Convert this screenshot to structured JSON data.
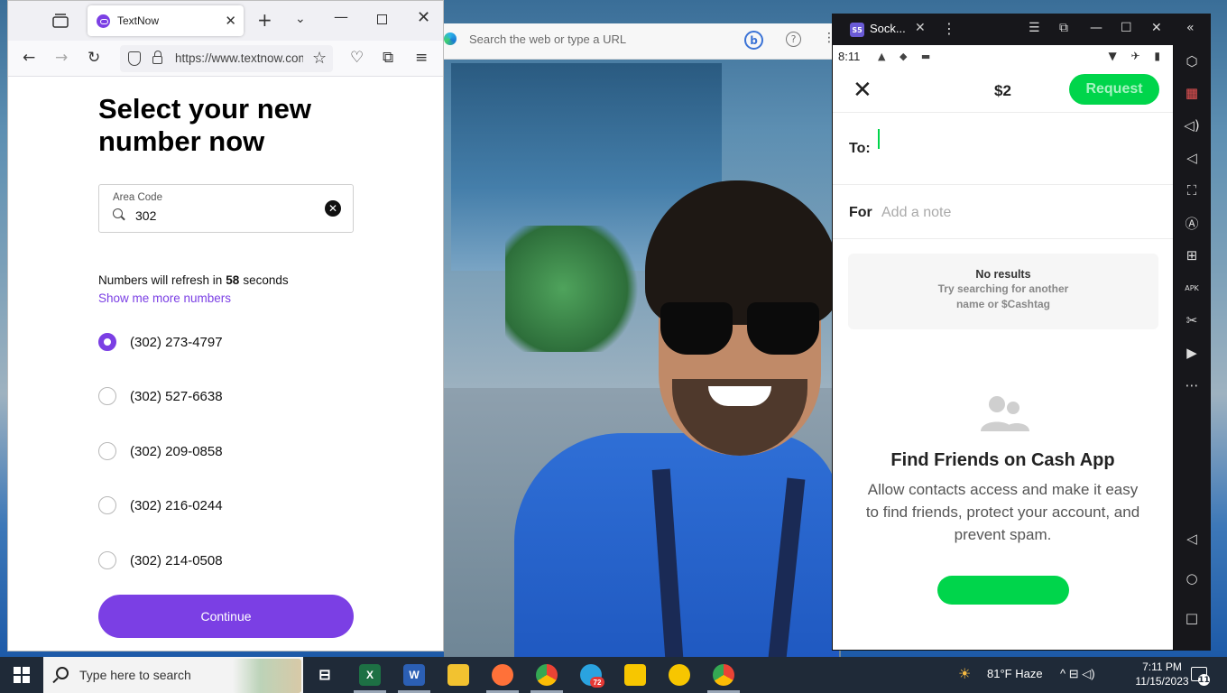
{
  "edge": {
    "search_placeholder": "Search the web or type a URL",
    "bing_label": "b",
    "help_label": "?",
    "more_label": "⋮"
  },
  "firefox": {
    "tab_title": "TextNow",
    "url": "https://www.textnow.com",
    "newtab_label": "+",
    "list_tabs_label": "⌄",
    "min_label": "—",
    "close_label": "✕",
    "tab_close_label": "✕",
    "back_label": "←",
    "forward_label": "→",
    "reload_label": "↻",
    "star_label": "☆",
    "pocket_label": "♡",
    "extensions_label": "⧉",
    "menu_label": "≡"
  },
  "textnow": {
    "heading": "Select your new number now",
    "area_code_label": "Area Code",
    "area_code_value": "302",
    "clear_label": "✕",
    "refresh_prefix": "Numbers will refresh in",
    "refresh_seconds": "58",
    "refresh_suffix": "seconds",
    "more_numbers_link": "Show me more numbers",
    "numbers": [
      {
        "number": "(302) 273-4797",
        "selected": true
      },
      {
        "number": "(302) 527-6638",
        "selected": false
      },
      {
        "number": "(302) 209-0858",
        "selected": false
      },
      {
        "number": "(302) 216-0244",
        "selected": false
      },
      {
        "number": "(302) 214-0508",
        "selected": false
      }
    ],
    "continue_label": "Continue",
    "accent_color": "#7b3fe4"
  },
  "emulator": {
    "window_title": "Sock...",
    "icon_label": "S5",
    "tab_close": "✕",
    "menu_dots": "⋮",
    "controls": [
      "☰",
      "⧉",
      "—",
      "☐",
      "✕",
      "«"
    ],
    "side_icons": [
      "settings-icon",
      "screenshot-disabled-icon",
      "volume-up-icon",
      "volume-down-icon",
      "fullscreen-icon",
      "rotate-icon",
      "add-window-icon",
      "apk-icon",
      "scissors-icon",
      "media-icon",
      "more-icon",
      "back-nav-icon",
      "home-nav-icon",
      "recent-nav-icon"
    ],
    "side_glyphs": [
      "⬡",
      "▦",
      "◁)",
      "◁",
      "⛶",
      "Ⓐ",
      "⊞",
      "APK",
      "✂",
      "▶",
      "⋯",
      "◁",
      "○",
      "□"
    ]
  },
  "cashapp": {
    "status_time": "8:11",
    "status_left_icons": "▲ ◆ ▬",
    "status_right_icons": "▼ ✈ ▮",
    "close_label": "✕",
    "amount": "$2",
    "request_label": "Request",
    "to_label": "To:",
    "for_label": "For",
    "note_placeholder": "Add a note",
    "no_results_title": "No results",
    "no_results_sub": "Try searching for another name or $Cashtag",
    "find_friends_title": "Find Friends on Cash App",
    "find_friends_body": "Allow contacts access and make it easy to find friends, protect your account, and prevent spam.",
    "brand_color": "#00d54b"
  },
  "taskbar": {
    "search_placeholder": "Type here to search",
    "apps": [
      {
        "name": "task-view",
        "label": "⊟",
        "color": "transparent"
      },
      {
        "name": "excel",
        "label": "X",
        "color": "#1d7044"
      },
      {
        "name": "word",
        "label": "W",
        "color": "#2b5fb4"
      },
      {
        "name": "file-explorer",
        "label": "",
        "color": "#f2c230"
      },
      {
        "name": "firefox",
        "label": "",
        "color": "#ff7139"
      },
      {
        "name": "chrome",
        "label": "",
        "color": "#1a73e8"
      },
      {
        "name": "telegram",
        "label": "",
        "color": "#2aa3e0"
      },
      {
        "name": "app-yellow-1",
        "label": "",
        "color": "#f7c600"
      },
      {
        "name": "app-yellow-2",
        "label": "",
        "color": "#f7c600"
      },
      {
        "name": "chrome-2",
        "label": "",
        "color": "#1a73e8"
      }
    ],
    "telegram_badge": "72",
    "weather": "81°F  Haze",
    "tray_icons": "^  ⊟  ◁)",
    "time": "7:11 PM",
    "date": "11/15/2023",
    "notification_count": "11"
  }
}
